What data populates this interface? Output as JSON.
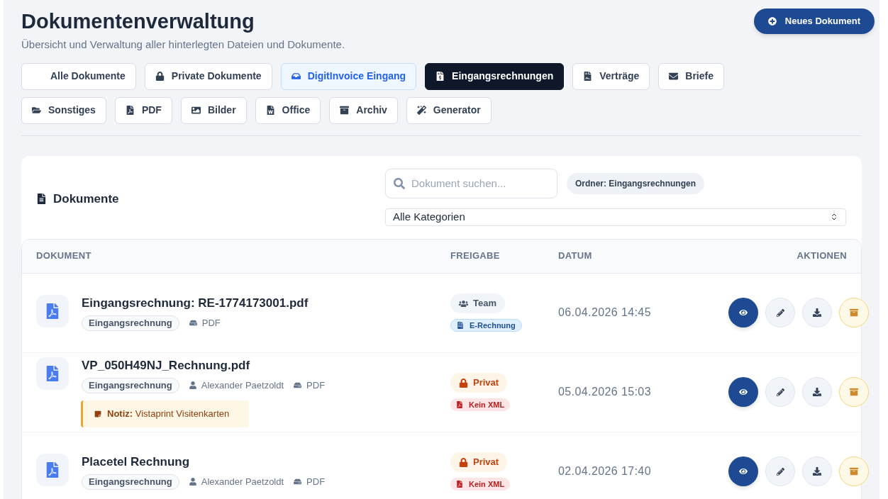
{
  "header": {
    "title": "Dokumentenverwaltung",
    "subtitle": "Übersicht und Verwaltung aller hinterlegten Dateien und Dokumente.",
    "new_button": "Neues Dokument"
  },
  "folders": [
    {
      "label": "Alle Dokumente",
      "kind": "all",
      "selected": false
    },
    {
      "label": "Private Dokumente",
      "kind": "private",
      "selected": false
    },
    {
      "label": "DigitInvoice Eingang",
      "kind": "inbox",
      "selected": false
    },
    {
      "label": "Eingangsrechnungen",
      "kind": "invoice",
      "selected": true
    },
    {
      "label": "Verträge",
      "kind": "contract",
      "selected": false
    },
    {
      "label": "Briefe",
      "kind": "letter",
      "selected": false
    },
    {
      "label": "Sonstiges",
      "kind": "misc",
      "selected": false
    },
    {
      "label": "PDF",
      "kind": "pdf",
      "selected": false
    },
    {
      "label": "Bilder",
      "kind": "image",
      "selected": false
    },
    {
      "label": "Office",
      "kind": "office",
      "selected": false
    },
    {
      "label": "Archiv",
      "kind": "archive",
      "selected": false
    },
    {
      "label": "Generator",
      "kind": "generator",
      "selected": false
    }
  ],
  "documents": {
    "title": "Dokumente",
    "search": {
      "placeholder": "Dokument suchen..."
    },
    "folder_chip": "Ordner: Eingangsrechnungen",
    "category_select": "Alle Kategorien",
    "columns": [
      "DOKUMENT",
      "FREIGABE",
      "DATUM",
      "AKTIONEN"
    ],
    "rows": [
      {
        "name": "Eingangsrechnung: RE-1774173001.pdf",
        "category": "Eingangsrechnung",
        "meta": [
          {
            "kind": "type",
            "text": "PDF"
          }
        ],
        "share": {
          "kind": "team",
          "label": "Team"
        },
        "einvoice": {
          "kind": "erechnung",
          "label": "E-Rechnung"
        },
        "date": "06.04.2026 14:45"
      },
      {
        "name": "VP_050H49NJ_Rechnung.pdf",
        "category": "Eingangsrechnung",
        "meta": [
          {
            "kind": "owner",
            "text": "Alexander Paetzoldt"
          },
          {
            "kind": "type",
            "text": "PDF"
          }
        ],
        "note": {
          "label": "Notiz:",
          "text": "Vistaprint Visitenkarten"
        },
        "share": {
          "kind": "private",
          "label": "Privat"
        },
        "einvoice": {
          "kind": "no_xml",
          "label": "Kein XML"
        },
        "date": "05.04.2026 15:03"
      },
      {
        "name": "Placetel Rechnung",
        "category": "Eingangsrechnung",
        "meta": [
          {
            "kind": "owner",
            "text": "Alexander Paetzoldt"
          },
          {
            "kind": "type",
            "text": "PDF"
          }
        ],
        "share": {
          "kind": "private",
          "label": "Privat"
        },
        "einvoice": {
          "kind": "no_xml",
          "label": "Kein XML"
        },
        "date": "02.04.2026 17:40"
      }
    ]
  }
}
